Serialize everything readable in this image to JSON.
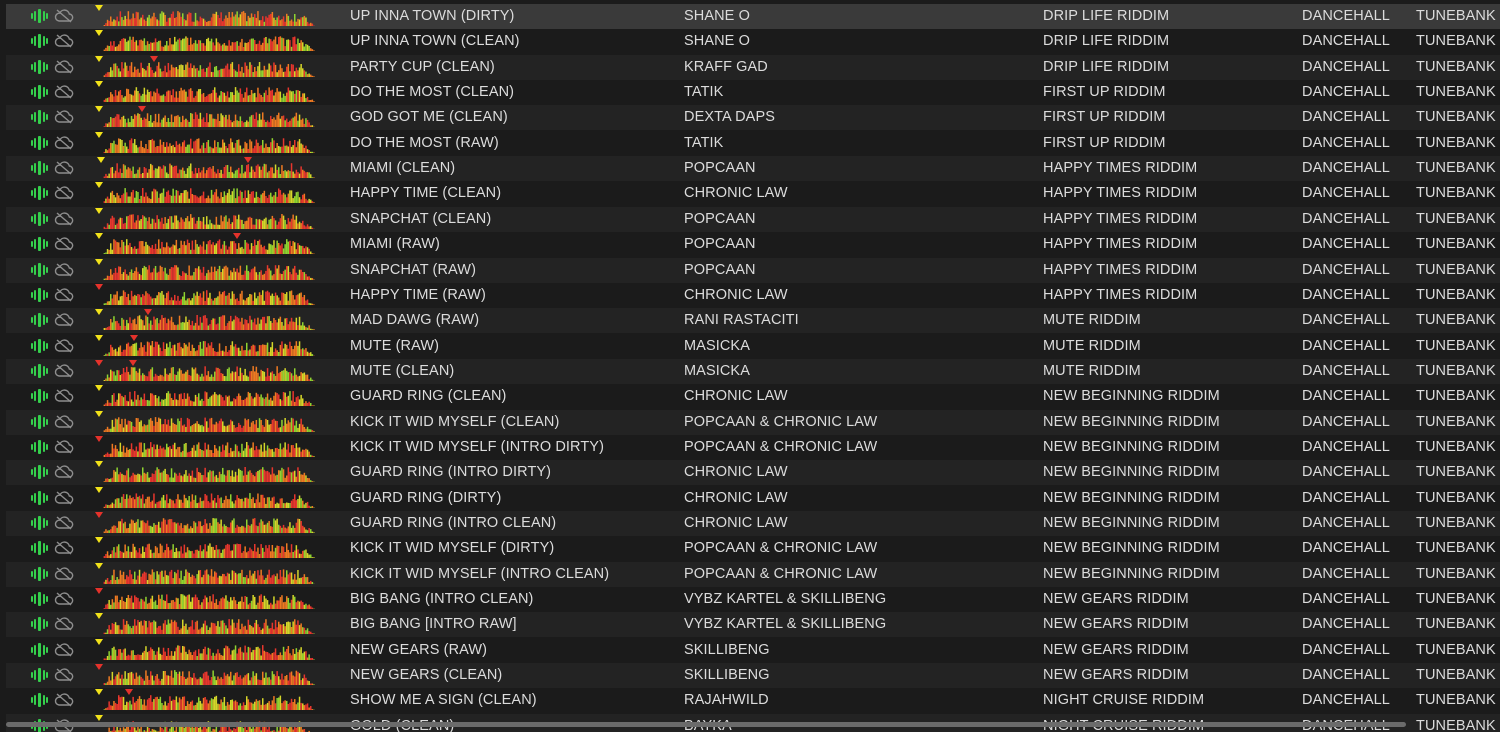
{
  "colors": {
    "row_odd": "#232323",
    "row_even": "#1b1b1b",
    "row_selected": "#3a3a3a",
    "text": "#dcdcdc",
    "eq_icon": "#34d04c",
    "cloud_icon": "#8e8e8e",
    "cue_yellow": "#f2e21a",
    "cue_red": "#e5322b",
    "wave_red": "#e8362d",
    "wave_orange": "#ee7a22",
    "wave_yellow": "#d4d62a",
    "wave_green": "#8fd330"
  },
  "icons": {
    "eq": "equalizer-bars-icon",
    "cloud": "cloud-offline-icon",
    "cue": "cue-marker-triangle"
  },
  "tracks": [
    {
      "title": "UP INNA TOWN (DIRTY)",
      "artist": "SHANE O",
      "album": "DRIP LIFE RIDDIM",
      "genre": "DANCEHALL",
      "label": "TUNEBANK",
      "selected": true
    },
    {
      "title": "UP INNA TOWN (CLEAN)",
      "artist": "SHANE O",
      "album": "DRIP LIFE RIDDIM",
      "genre": "DANCEHALL",
      "label": "TUNEBANK"
    },
    {
      "title": "PARTY CUP (CLEAN)",
      "artist": "KRAFF GAD",
      "album": "DRIP LIFE RIDDIM",
      "genre": "DANCEHALL",
      "label": "TUNEBANK"
    },
    {
      "title": "DO THE MOST (CLEAN)",
      "artist": "TATIK",
      "album": "FIRST UP RIDDIM",
      "genre": "DANCEHALL",
      "label": "TUNEBANK"
    },
    {
      "title": "GOD GOT ME (CLEAN)",
      "artist": "DEXTA DAPS",
      "album": "FIRST UP RIDDIM",
      "genre": "DANCEHALL",
      "label": "TUNEBANK"
    },
    {
      "title": "DO THE MOST (RAW)",
      "artist": "TATIK",
      "album": "FIRST UP RIDDIM",
      "genre": "DANCEHALL",
      "label": "TUNEBANK"
    },
    {
      "title": "MIAMI (CLEAN)",
      "artist": "POPCAAN",
      "album": "HAPPY TIMES RIDDIM",
      "genre": "DANCEHALL",
      "label": "TUNEBANK"
    },
    {
      "title": "HAPPY TIME (CLEAN)",
      "artist": "CHRONIC LAW",
      "album": "HAPPY TIMES RIDDIM",
      "genre": "DANCEHALL",
      "label": "TUNEBANK"
    },
    {
      "title": "SNAPCHAT (CLEAN)",
      "artist": "POPCAAN",
      "album": "HAPPY TIMES RIDDIM",
      "genre": "DANCEHALL",
      "label": "TUNEBANK"
    },
    {
      "title": "MIAMI (RAW)",
      "artist": "POPCAAN",
      "album": "HAPPY TIMES RIDDIM",
      "genre": "DANCEHALL",
      "label": "TUNEBANK"
    },
    {
      "title": "SNAPCHAT (RAW)",
      "artist": "POPCAAN",
      "album": "HAPPY TIMES RIDDIM",
      "genre": "DANCEHALL",
      "label": "TUNEBANK"
    },
    {
      "title": "HAPPY TIME (RAW)",
      "artist": "CHRONIC LAW",
      "album": "HAPPY TIMES RIDDIM",
      "genre": "DANCEHALL",
      "label": "TUNEBANK"
    },
    {
      "title": "MAD DAWG (RAW)",
      "artist": "RANI RASTACITI",
      "album": "MUTE RIDDIM",
      "genre": "DANCEHALL",
      "label": "TUNEBANK"
    },
    {
      "title": "MUTE (RAW)",
      "artist": "MASICKA",
      "album": "MUTE RIDDIM",
      "genre": "DANCEHALL",
      "label": "TUNEBANK"
    },
    {
      "title": "MUTE (CLEAN)",
      "artist": "MASICKA",
      "album": "MUTE RIDDIM",
      "genre": "DANCEHALL",
      "label": "TUNEBANK"
    },
    {
      "title": "GUARD RING (CLEAN)",
      "artist": "CHRONIC LAW",
      "album": "NEW BEGINNING RIDDIM",
      "genre": "DANCEHALL",
      "label": "TUNEBANK"
    },
    {
      "title": "KICK IT WID MYSELF (CLEAN)",
      "artist": "POPCAAN & CHRONIC LAW",
      "album": "NEW BEGINNING RIDDIM",
      "genre": "DANCEHALL",
      "label": "TUNEBANK"
    },
    {
      "title": "KICK IT WID MYSELF (INTRO DIRTY)",
      "artist": "POPCAAN & CHRONIC LAW",
      "album": "NEW BEGINNING RIDDIM",
      "genre": "DANCEHALL",
      "label": "TUNEBANK"
    },
    {
      "title": "GUARD RING (INTRO DIRTY)",
      "artist": "CHRONIC LAW",
      "album": "NEW BEGINNING RIDDIM",
      "genre": "DANCEHALL",
      "label": "TUNEBANK"
    },
    {
      "title": "GUARD RING (DIRTY)",
      "artist": "CHRONIC LAW",
      "album": "NEW BEGINNING RIDDIM",
      "genre": "DANCEHALL",
      "label": "TUNEBANK"
    },
    {
      "title": "GUARD RING (INTRO CLEAN)",
      "artist": "CHRONIC LAW",
      "album": "NEW BEGINNING RIDDIM",
      "genre": "DANCEHALL",
      "label": "TUNEBANK"
    },
    {
      "title": "KICK IT WID MYSELF (DIRTY)",
      "artist": "POPCAAN & CHRONIC LAW",
      "album": "NEW BEGINNING RIDDIM",
      "genre": "DANCEHALL",
      "label": "TUNEBANK"
    },
    {
      "title": "KICK IT WID MYSELF (INTRO CLEAN)",
      "artist": "POPCAAN & CHRONIC LAW",
      "album": "NEW BEGINNING RIDDIM",
      "genre": "DANCEHALL",
      "label": "TUNEBANK"
    },
    {
      "title": "BIG BANG (INTRO CLEAN)",
      "artist": "VYBZ KARTEL & SKILLIBENG",
      "album": "NEW GEARS RIDDIM",
      "genre": "DANCEHALL",
      "label": "TUNEBANK"
    },
    {
      "title": "BIG BANG [INTRO RAW]",
      "artist": "VYBZ KARTEL & SKILLIBENG",
      "album": "NEW GEARS RIDDIM",
      "genre": "DANCEHALL",
      "label": "TUNEBANK"
    },
    {
      "title": "NEW GEARS (RAW)",
      "artist": "SKILLIBENG",
      "album": "NEW GEARS RIDDIM",
      "genre": "DANCEHALL",
      "label": "TUNEBANK"
    },
    {
      "title": "NEW GEARS (CLEAN)",
      "artist": "SKILLIBENG",
      "album": "NEW GEARS RIDDIM",
      "genre": "DANCEHALL",
      "label": "TUNEBANK"
    },
    {
      "title": "SHOW ME A SIGN (CLEAN)",
      "artist": "RAJAHWILD",
      "album": "NIGHT CRUISE RIDDIM",
      "genre": "DANCEHALL",
      "label": "TUNEBANK"
    },
    {
      "title": "GOLD (CLEAN)",
      "artist": "BAYKA",
      "album": "NIGHT CRUISE RIDDIM",
      "genre": "DANCEHALL",
      "label": "TUNEBANK"
    }
  ]
}
